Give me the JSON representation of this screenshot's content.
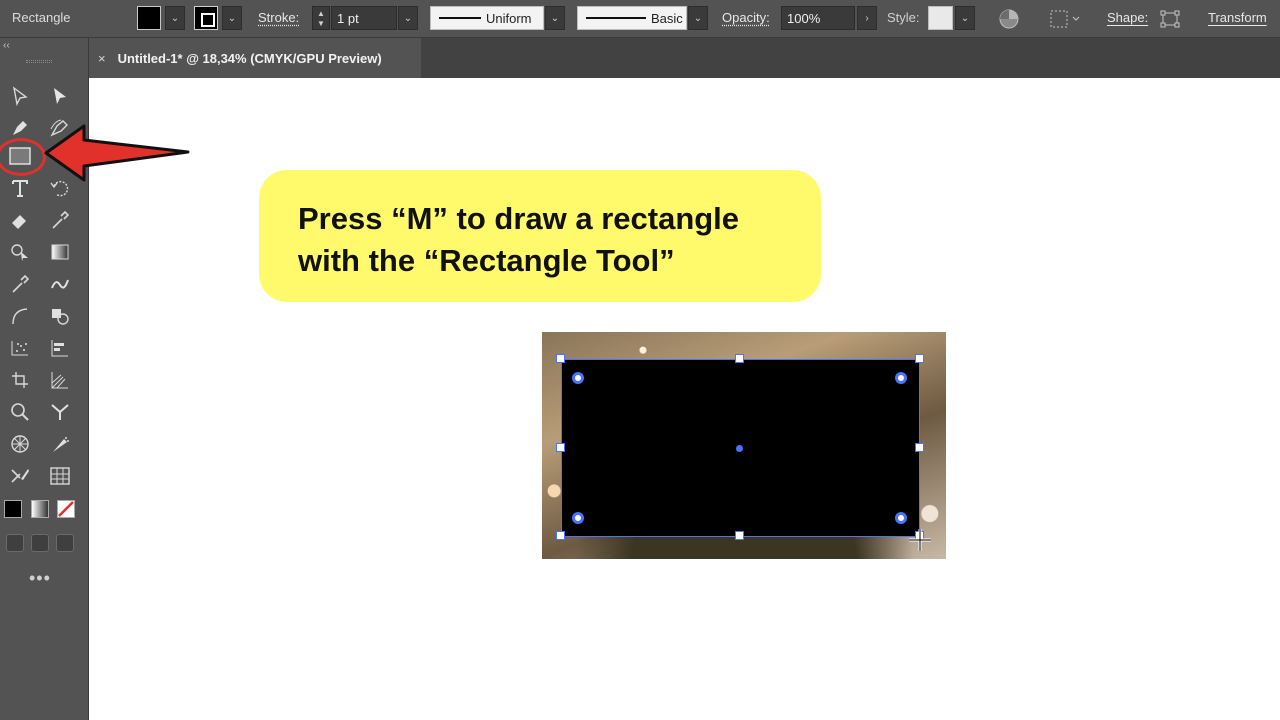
{
  "control_bar": {
    "tool_name": "Rectangle",
    "stroke_label": "Stroke:",
    "stroke_weight": "1 pt",
    "variable_width": "Uniform",
    "brush": "Basic",
    "opacity_label": "Opacity:",
    "opacity_value": "100%",
    "style_label": "Style:",
    "shape_label": "Shape:",
    "transform_label": "Transform"
  },
  "tab": {
    "close_symbol": "×",
    "title": "Untitled-1* @ 18,34% (CMYK/GPU Preview)"
  },
  "toolbar": {
    "collapse_symbol": "‹‹",
    "more_symbol": "•••",
    "active_tool": "rectangle-tool"
  },
  "callout": {
    "line1": "Press “M” to draw a rectangle",
    "line2": "with the “Rectangle Tool”",
    "color": "#fffa6b"
  },
  "colors": {
    "accent_selection": "#4a74ff",
    "highlight": "#e2312b"
  }
}
